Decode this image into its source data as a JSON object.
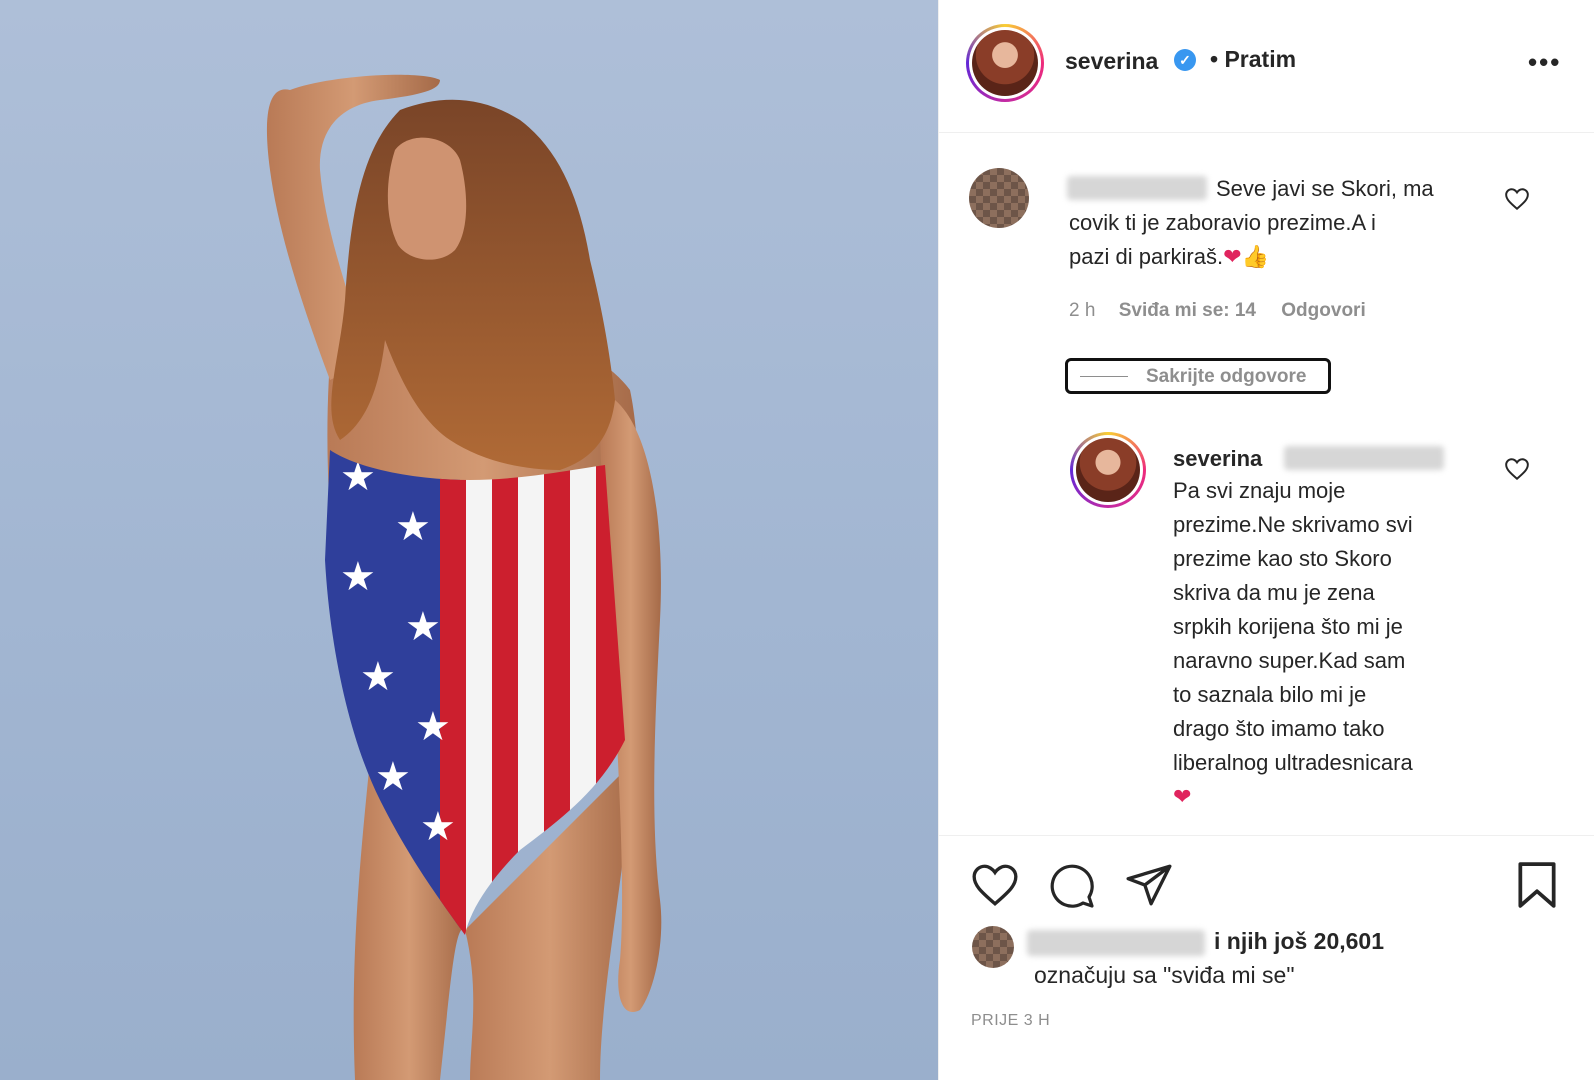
{
  "post_image": {
    "alt": ""
  },
  "header": {
    "username": "severina",
    "verified_mark": "✓",
    "separator": "•",
    "follow_status": "Pratim",
    "more_label": "•••"
  },
  "comment": {
    "text_line1": "Seve javi se Skori, ma",
    "text_line2": "covik ti je zaboravio prezime.A i",
    "text_line3": "pazi di parkiraš.",
    "emojis": "❤👍",
    "time": "2 h",
    "likes": "Sviđa mi se: 14",
    "reply_label": "Odgovori"
  },
  "hide_replies_label": "Sakrijte odgovore",
  "reply": {
    "username": "severina",
    "lines": [
      "Pa svi znaju moje",
      "prezime.Ne skrivamo svi",
      "prezime kao sto Skoro",
      "skriva da mu je zena",
      "srpkih korijena što mi je",
      "naravno super.Kad sam",
      "to saznala bilo mi je",
      "drago što imamo tako",
      "liberalnog ultradesnicara"
    ],
    "emoji": "❤"
  },
  "actions": {
    "like_icon": "heart-icon",
    "comment_icon": "comment-icon",
    "share_icon": "share-icon",
    "save_icon": "bookmark-icon"
  },
  "likes": {
    "count_text": "i njih još 20,601",
    "suffix": "označuju sa \"sviđa mi se\""
  },
  "timestamp": "PRIJE 3 H",
  "colors": {
    "accent": "#3897f0",
    "muted": "#8e8e8e",
    "text": "#262626"
  }
}
